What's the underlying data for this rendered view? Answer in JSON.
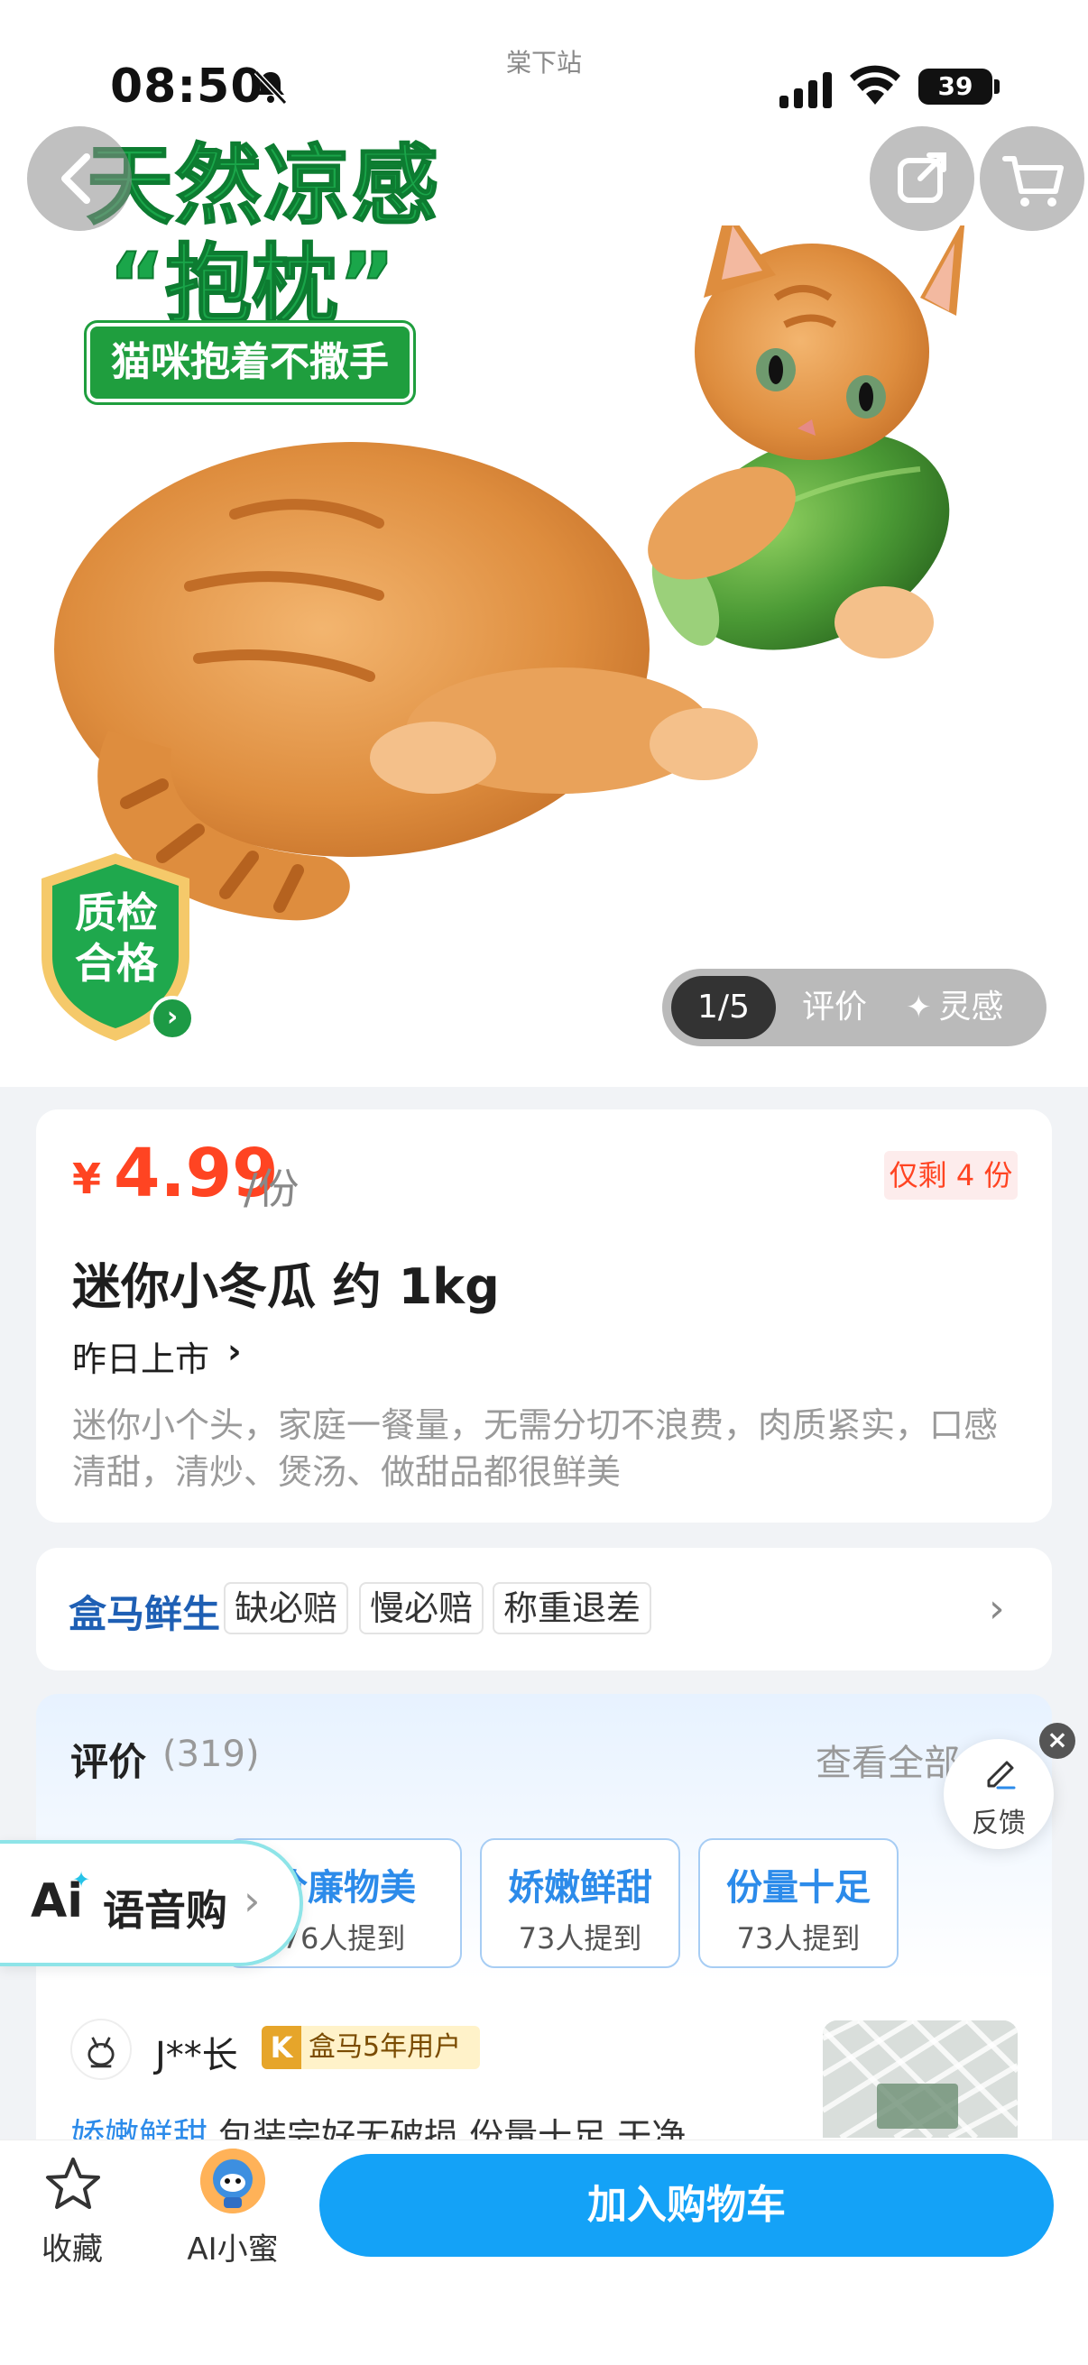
{
  "status_bar": {
    "time": "08:50",
    "station": "棠下站",
    "battery": "39"
  },
  "hero": {
    "promo_title_line1": "天然凉感",
    "promo_title_line2": "“抱枕”",
    "promo_tag": "猫咪抱着不撒手",
    "qc_badge_line1": "质检",
    "qc_badge_line2": "合格",
    "gallery_index": "1/5",
    "gallery_review_tab": "评价",
    "gallery_inspo_tab": "灵感",
    "icons": [
      "back-icon",
      "share-icon",
      "cart-icon",
      "bell-off-icon",
      "signal-icon",
      "wifi-icon"
    ]
  },
  "product": {
    "currency": "¥",
    "price": "4.99",
    "unit": "/份",
    "stock_badge": "仅剩 4 份",
    "name": "迷你小冬瓜  约 1kg",
    "listed": "昨日上市",
    "description": "迷你小个头，家庭一餐量，无需分切不浪费，肉质紧实，口感清甜，清炒、煲汤、做甜品都很鲜美",
    "colors": {
      "price": "#ff4422",
      "accent": "#14a2f7",
      "brand": "#1e5fb4"
    }
  },
  "service": {
    "brand": "盒马鲜生",
    "tags": [
      "缺必赔",
      "慢必赔",
      "称重退差"
    ]
  },
  "reviews": {
    "title": "评价",
    "count": "(319)",
    "view_all": "查看全部",
    "keywords": [
      {
        "title": "价廉物美",
        "mentions": "76人提到"
      },
      {
        "title": "娇嫩鲜甜",
        "mentions": "73人提到"
      },
      {
        "title": "份量十足",
        "mentions": "73人提到"
      }
    ],
    "first_review": {
      "user": "J**长",
      "badge_k": "K",
      "badge": "盒马5年用户",
      "highlight": "娇嫩鲜甜",
      "text": " 包装完好无破损 份量十足 干净"
    }
  },
  "ai_voice": {
    "logo": "Ai",
    "label": "语音购"
  },
  "feedback": {
    "label": "反馈",
    "close": "×"
  },
  "bottom_bar": {
    "favorite": "收藏",
    "ai_assistant": "AI小蜜",
    "add_to_cart": "加入购物车"
  }
}
